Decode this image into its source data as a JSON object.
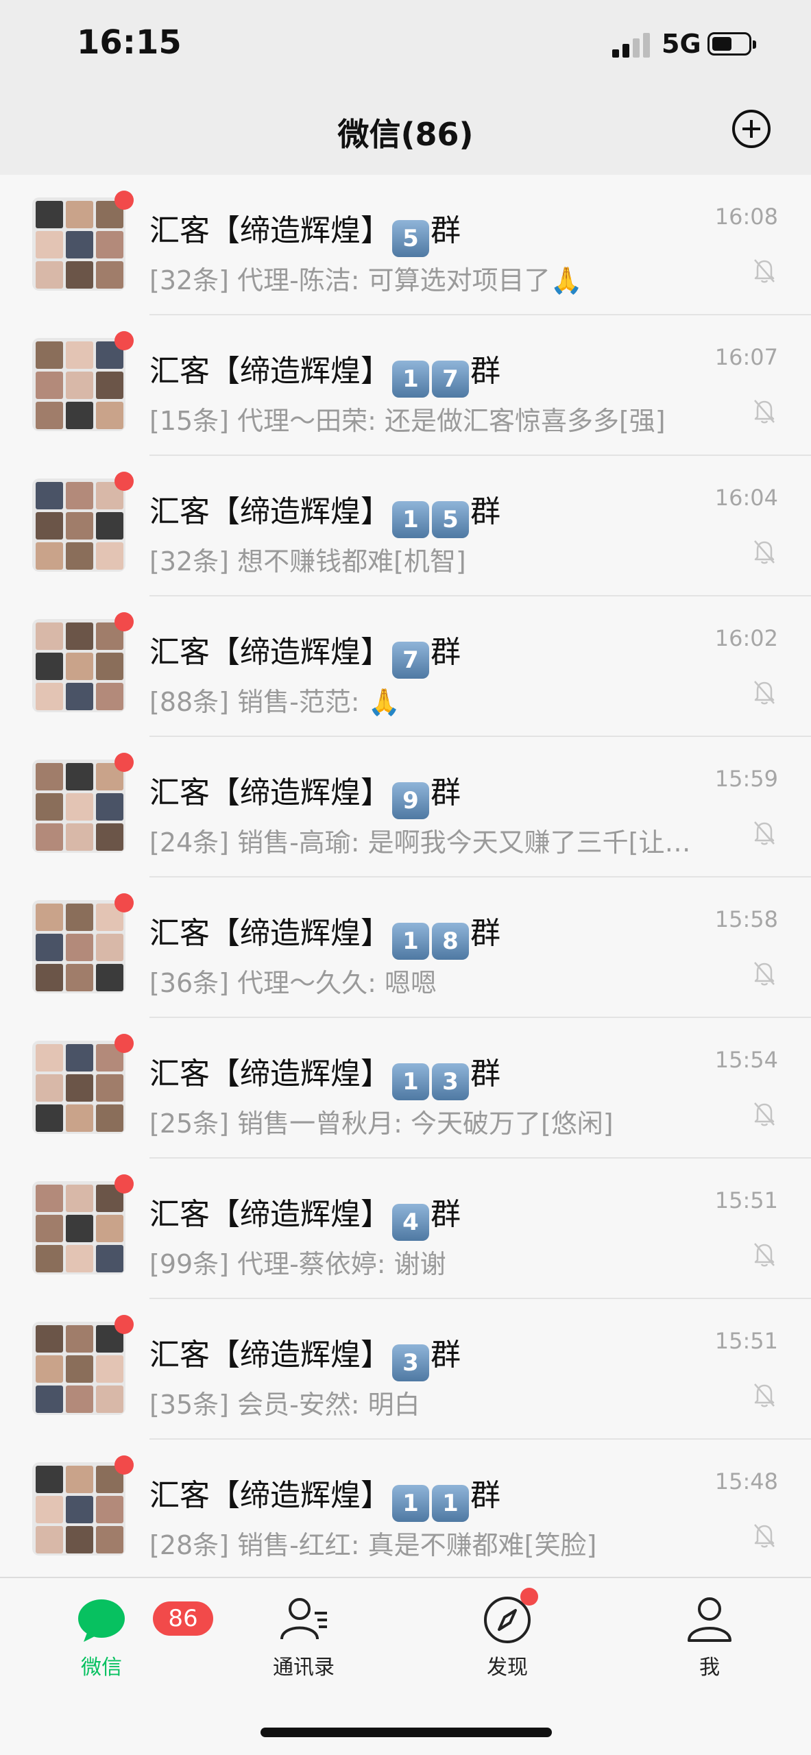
{
  "status_bar": {
    "time": "16:15",
    "network": "5G",
    "battery_level": 0.55
  },
  "header": {
    "title": "微信(86)",
    "add_icon": "plus-circle-icon"
  },
  "chats": [
    {
      "name_prefix": "汇客【缔造辉煌】",
      "number_badges": [
        "5"
      ],
      "name_suffix": "群",
      "time": "16:08",
      "preview": "[32条] 代理-陈洁: 可算选对项目了🙏",
      "muted": true,
      "unread_dot": true
    },
    {
      "name_prefix": "汇客【缔造辉煌】",
      "number_badges": [
        "1",
        "7"
      ],
      "name_suffix": "群",
      "time": "16:07",
      "preview": "[15条] 代理～田荣: 还是做汇客惊喜多多[强]",
      "muted": true,
      "unread_dot": true
    },
    {
      "name_prefix": "汇客【缔造辉煌】",
      "number_badges": [
        "1",
        "5"
      ],
      "name_suffix": "群",
      "time": "16:04",
      "preview": "[32条] 想不赚钱都难[机智]",
      "muted": true,
      "unread_dot": true
    },
    {
      "name_prefix": "汇客【缔造辉煌】",
      "number_badges": [
        "7"
      ],
      "name_suffix": "群",
      "time": "16:02",
      "preview": "[88条] 销售-范范: 🙏",
      "muted": true,
      "unread_dot": true
    },
    {
      "name_prefix": "汇客【缔造辉煌】",
      "number_badges": [
        "9"
      ],
      "name_suffix": "群",
      "time": "15:59",
      "preview": "[24条] 销售-高瑜: 是啊我今天又赚了三千[让…",
      "muted": true,
      "unread_dot": true
    },
    {
      "name_prefix": "汇客【缔造辉煌】",
      "number_badges": [
        "1",
        "8"
      ],
      "name_suffix": "群",
      "time": "15:58",
      "preview": "[36条] 代理～久久: 嗯嗯",
      "muted": true,
      "unread_dot": true
    },
    {
      "name_prefix": "汇客【缔造辉煌】",
      "number_badges": [
        "1",
        "3"
      ],
      "name_suffix": "群",
      "time": "15:54",
      "preview": "[25条] 销售一曾秋月: 今天破万了[悠闲]",
      "muted": true,
      "unread_dot": true
    },
    {
      "name_prefix": "汇客【缔造辉煌】",
      "number_badges": [
        "4"
      ],
      "name_suffix": "群",
      "time": "15:51",
      "preview": "[99条] 代理-蔡依婷: 谢谢",
      "muted": true,
      "unread_dot": true
    },
    {
      "name_prefix": "汇客【缔造辉煌】",
      "number_badges": [
        "3"
      ],
      "name_suffix": "群",
      "time": "15:51",
      "preview": "[35条] 会员-安然: 明白",
      "muted": true,
      "unread_dot": true
    },
    {
      "name_prefix": "汇客【缔造辉煌】",
      "number_badges": [
        "1",
        "1"
      ],
      "name_suffix": "群",
      "time": "15:48",
      "preview": "[28条] 销售-红红: 真是不赚都难[笑脸]",
      "muted": true,
      "unread_dot": true
    }
  ],
  "tabbar": {
    "tabs": [
      {
        "label": "微信",
        "icon": "chat-bubble-icon",
        "active": true,
        "badge": "86"
      },
      {
        "label": "通讯录",
        "icon": "contacts-icon",
        "active": false
      },
      {
        "label": "发现",
        "icon": "compass-icon",
        "active": false,
        "dot": true
      },
      {
        "label": "我",
        "icon": "person-icon",
        "active": false
      }
    ]
  },
  "colors": {
    "accent_green": "#07c160",
    "badge_red": "#f24a4a",
    "muted_text": "#9a9a9a"
  }
}
